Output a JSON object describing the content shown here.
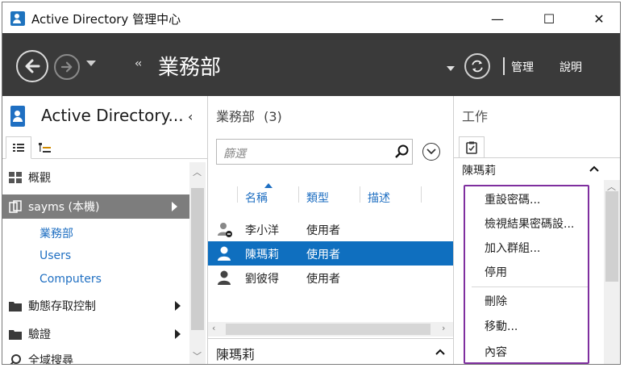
{
  "window": {
    "title": "Active Directory 管理中心",
    "minimize": "—",
    "maximize": "☐",
    "close": "✕"
  },
  "nav": {
    "breadcrumb_arrows": "‹‹",
    "breadcrumb": "業務部",
    "menu_manage": "管理",
    "menu_help": "說明"
  },
  "left_panel": {
    "title": "Active Directory...",
    "collapse": "‹",
    "items": [
      {
        "label": "概觀",
        "icon": "overview-icon"
      },
      {
        "label": "sayms (本機)",
        "icon": "domain-icon",
        "selected": true
      },
      {
        "label": "動態存取控制",
        "icon": "folder-icon"
      },
      {
        "label": "驗證",
        "icon": "folder-icon"
      },
      {
        "label": "全域搜尋",
        "icon": "search-icon"
      }
    ],
    "sub_items": [
      "業務部",
      "Users",
      "Computers"
    ]
  },
  "middle_panel": {
    "title": "業務部",
    "count": "(3)",
    "search_placeholder": "篩選",
    "columns": [
      "名稱",
      "類型",
      "描述"
    ],
    "rows": [
      {
        "name": "李小洋",
        "type": "使用者",
        "selected": false,
        "disabled": true
      },
      {
        "name": "陳瑪莉",
        "type": "使用者",
        "selected": true,
        "disabled": false
      },
      {
        "name": "劉彼得",
        "type": "使用者",
        "selected": false,
        "disabled": false
      }
    ],
    "details_label": "陳瑪莉"
  },
  "right_panel": {
    "title": "工作",
    "section_label": "陳瑪莉",
    "tasks": [
      "重設密碼...",
      "檢視結果密碼設...",
      "加入群組...",
      "停用",
      "刪除",
      "移動...",
      "內容"
    ]
  },
  "colors": {
    "nav_bg": "#3a3a3a",
    "accent": "#1f6fc2",
    "selection": "#0f6fbf",
    "highlight_border": "#7f2f9f"
  }
}
